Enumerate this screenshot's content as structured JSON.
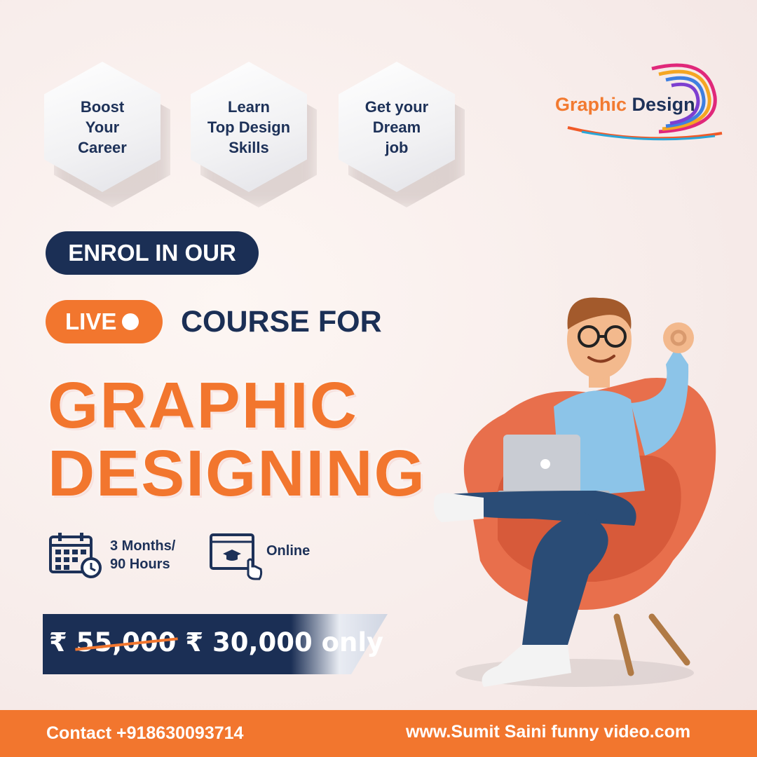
{
  "features": [
    {
      "text": "Boost\nYour\nCareer"
    },
    {
      "text": "Learn\nTop Design\nSkills"
    },
    {
      "text": "Get your\nDream\njob"
    }
  ],
  "logo": {
    "word1": "Graphic",
    "word2": "Design"
  },
  "enrol": "ENROL IN OUR",
  "live": "LIVE",
  "course_for": "COURSE FOR",
  "title_line1": "GRAPHIC",
  "title_line2": "DESIGNING",
  "duration": "3 Months/\n90 Hours",
  "mode": "Online",
  "price": {
    "currency": "₹",
    "old": "55,000",
    "new": "30,000 only"
  },
  "contact": "Contact  +918630093714",
  "website": "www.Sumit Saini funny video.com",
  "colors": {
    "orange": "#f2762e",
    "navy": "#1b2f55"
  }
}
